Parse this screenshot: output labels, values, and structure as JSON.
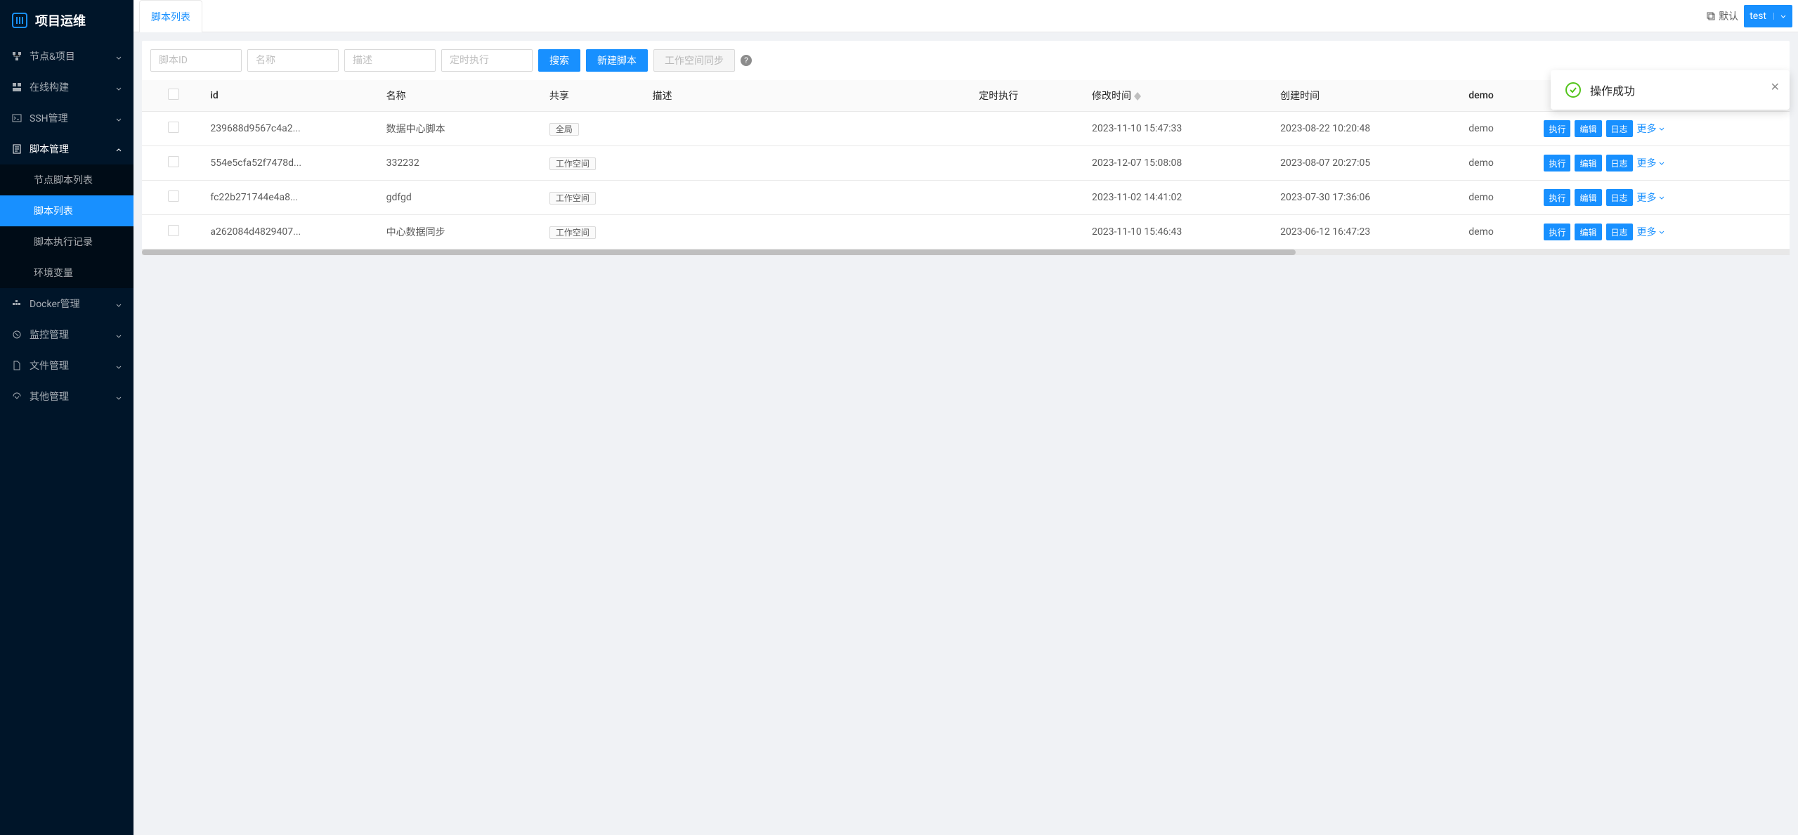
{
  "app": {
    "title": "项目运维"
  },
  "sidebar": {
    "items": [
      {
        "label": "节点&项目",
        "icon": "nodes-icon"
      },
      {
        "label": "在线构建",
        "icon": "build-icon"
      },
      {
        "label": "SSH管理",
        "icon": "ssh-icon"
      },
      {
        "label": "脚本管理",
        "icon": "script-icon",
        "expanded": true,
        "children": [
          {
            "label": "节点脚本列表"
          },
          {
            "label": "脚本列表",
            "active": true
          },
          {
            "label": "脚本执行记录"
          },
          {
            "label": "环境变量"
          }
        ]
      },
      {
        "label": "Docker管理",
        "icon": "docker-icon"
      },
      {
        "label": "监控管理",
        "icon": "monitor-icon"
      },
      {
        "label": "文件管理",
        "icon": "file-icon"
      },
      {
        "label": "其他管理",
        "icon": "other-icon"
      }
    ]
  },
  "tabs": {
    "active": "脚本列表"
  },
  "workspace": {
    "default_label": "默认",
    "current": "test"
  },
  "filters": {
    "script_id_placeholder": "脚本ID",
    "name_placeholder": "名称",
    "desc_placeholder": "描述",
    "cron_placeholder": "定时执行",
    "search_label": "搜索",
    "create_label": "新建脚本",
    "sync_label": "工作空间同步"
  },
  "table": {
    "headers": {
      "id": "id",
      "name": "名称",
      "share": "共享",
      "desc": "描述",
      "cron": "定时执行",
      "mtime": "修改时间",
      "ctime": "创建时间",
      "user": "demo",
      "actions": ""
    },
    "share_global": "全局",
    "share_workspace": "工作空间",
    "rows": [
      {
        "id": "239688d9567c4a2...",
        "name": "数据中心脚本",
        "share": "全局",
        "desc": "",
        "cron": "",
        "mtime": "2023-11-10 15:47:33",
        "ctime": "2023-08-22 10:20:48",
        "user": "demo"
      },
      {
        "id": "554e5cfa52f7478d...",
        "name": "332232",
        "share": "工作空间",
        "desc": "",
        "cron": "",
        "mtime": "2023-12-07 15:08:08",
        "ctime": "2023-08-07 20:27:05",
        "user": "demo"
      },
      {
        "id": "fc22b271744e4a8...",
        "name": "gdfgd",
        "share": "工作空间",
        "desc": "",
        "cron": "",
        "mtime": "2023-11-02 14:41:02",
        "ctime": "2023-07-30 17:36:06",
        "user": "demo"
      },
      {
        "id": "a262084d4829407...",
        "name": "中心数据同步",
        "share": "工作空间",
        "desc": "",
        "cron": "",
        "mtime": "2023-11-10 15:46:43",
        "ctime": "2023-06-12 16:47:23",
        "user": "demo"
      }
    ]
  },
  "actions": {
    "exec": "执行",
    "edit": "编辑",
    "log": "日志",
    "more": "更多"
  },
  "toast": {
    "message": "操作成功"
  }
}
